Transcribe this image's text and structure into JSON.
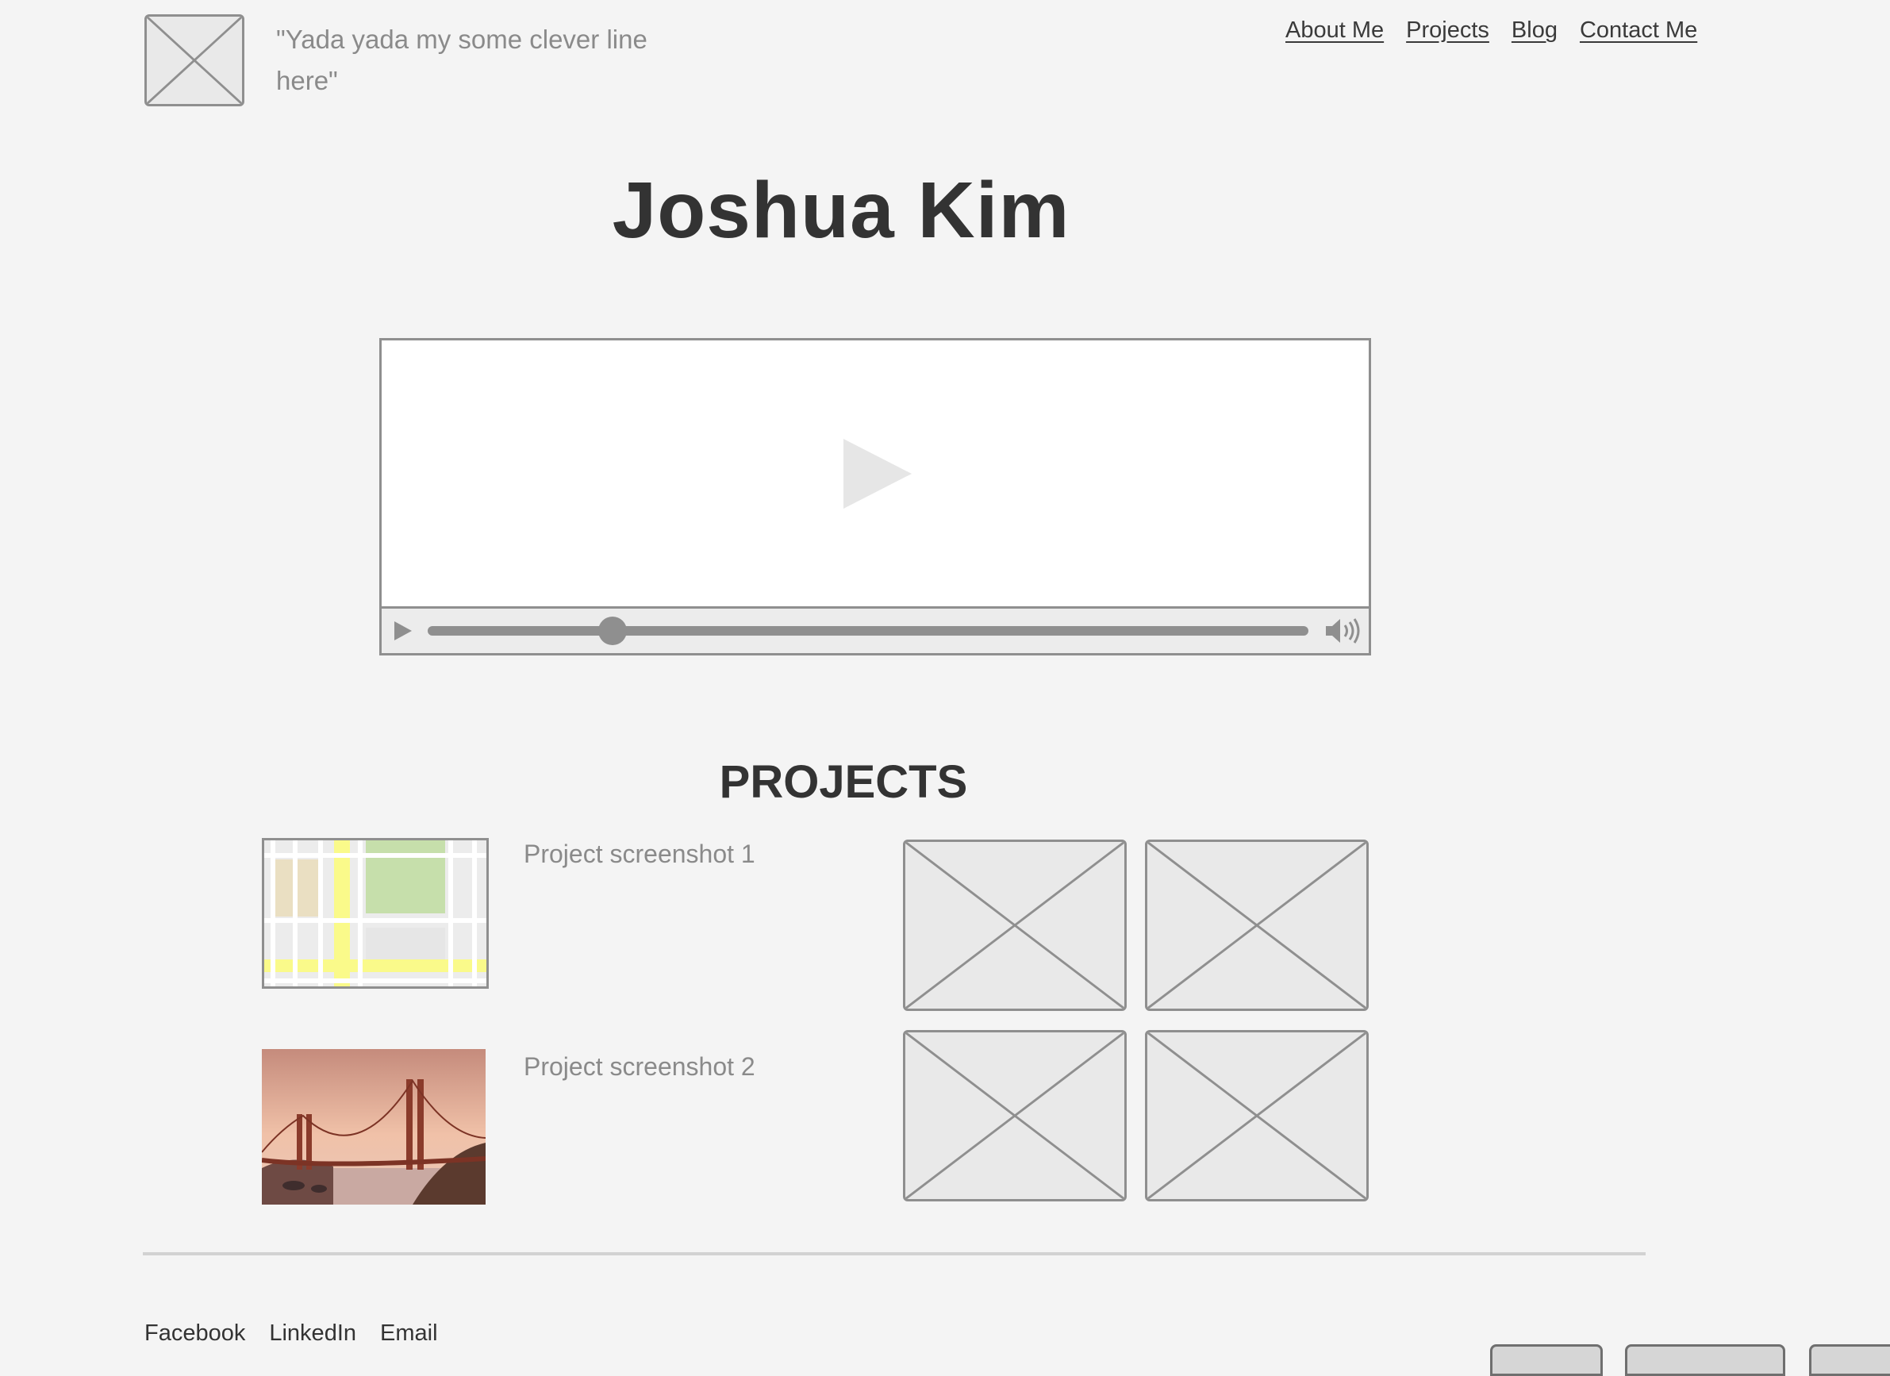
{
  "header": {
    "tagline": "\"Yada yada my some clever line here\"",
    "logo_icon": "image-placeholder-icon",
    "nav": [
      "About Me",
      "Projects",
      "Blog",
      "Contact Me"
    ]
  },
  "hero": {
    "title": "Joshua Kim"
  },
  "video_player": {
    "big_play_icon": "play-icon",
    "control_play_icon": "play-icon",
    "volume_icon": "volume-icon",
    "progress": 0.21
  },
  "projects": {
    "heading": "PROJECTS",
    "items": [
      {
        "caption": "Project screenshot 1",
        "thumbnail": "map-image"
      },
      {
        "caption": "Project screenshot 2",
        "thumbnail": "golden-gate-bridge-image"
      }
    ],
    "gallery_icon": "image-placeholder-icon"
  },
  "footer": {
    "links": [
      "Facebook",
      "LinkedIn",
      "Email"
    ]
  },
  "colors": {
    "background": "#f4f4f4",
    "placeholder_stroke": "#8f8f8f",
    "text_dark": "#333333",
    "text_muted": "#8a8a8a"
  }
}
